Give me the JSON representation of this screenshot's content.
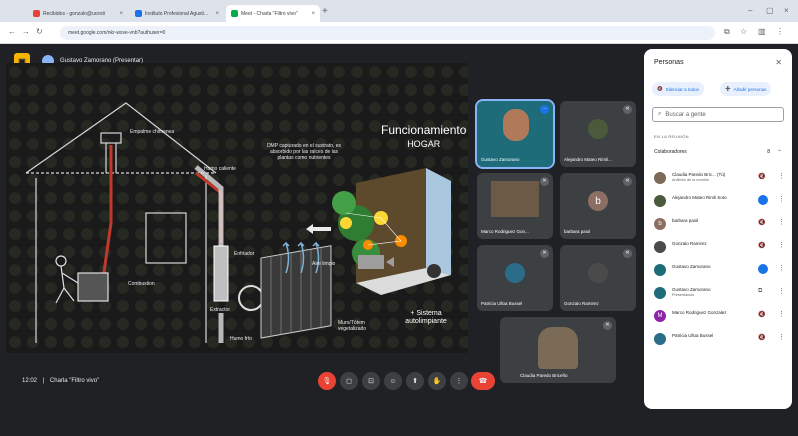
{
  "browser": {
    "tabs": [
      {
        "label": "Recibidos - gonzalo@ucesti",
        "fav": "#ea4335"
      },
      {
        "label": "Instituto Profesional Agusti...",
        "fav": "#1a73e8"
      },
      {
        "label": "Meet - Charla \"Filtro vivo\"",
        "fav": "#00ac47"
      }
    ],
    "url": "meet.google.com/nkr-wsve-vnb?authuser=0"
  },
  "presenter": {
    "name": "Gustavo Zamorano (Presentar)"
  },
  "slide": {
    "title": "Funcionamiento",
    "subtitle": "HOGAR",
    "labels": {
      "chimney": "Empalme chimenea",
      "hot_smoke": "Humo caliente",
      "cooler": "Enfriador",
      "clean_air": "Aire limpio",
      "combustion": "Combustion",
      "extractor": "Extractor",
      "cold_smoke": "Humo frío",
      "green_wall": "Muro/Tótem vegetalizado"
    },
    "note": "DMP capturado en el sustrato, es absorbido por las raíces de las plantas como nutrientes",
    "system": "+ Sistema autolimpiante"
  },
  "tiles": [
    {
      "name": "Gustavo Zamorano",
      "color": "#1e6b7a"
    },
    {
      "name": "Alejandro Mateo Rimli...",
      "color": "#4a5a3a"
    },
    {
      "name": "Marco Rodriguez Gon...",
      "color": "#5a4a3a"
    },
    {
      "name": "barbara paiol",
      "initial": "b",
      "color": "#8d6e63"
    },
    {
      "name": "Patricia Ulloa Bussel",
      "color": "#2b6c8a"
    },
    {
      "name": "Gonzalo Ramirez",
      "color": "#4a4a4a"
    },
    {
      "name": "Claudia Paredo Briceño",
      "color": "#7b6a55"
    }
  ],
  "controls": {
    "time": "12:02",
    "separator": "|",
    "meeting": "Charla \"Filtro vivo\""
  },
  "people": {
    "title": "Personas",
    "mute_all": "Silenciar a todos",
    "add_people": "Añadir personas",
    "search_placeholder": "Buscar a gente",
    "section": "EN LA REUNIÓN",
    "group": "Colaboradores",
    "group_count": "8",
    "list": [
      {
        "name": "Claudia Paredo Bric... (Tú)",
        "role": "Anfitrión de la reunión",
        "color": "#7b6a55",
        "icon": "mic-off"
      },
      {
        "name": "Alejandro Mateo Rimli Soto",
        "role": "",
        "color": "#4a5a3a",
        "icon": "speaking"
      },
      {
        "name": "barbara paiol",
        "role": "",
        "initial": "b",
        "color": "#8d6e63",
        "icon": "mic-off"
      },
      {
        "name": "Gonzalo Ramirez",
        "role": "",
        "color": "#4a4a4a",
        "icon": "mic-off"
      },
      {
        "name": "Gustavo Zamorano",
        "role": "",
        "color": "#1e6b7a",
        "icon": "speaking"
      },
      {
        "name": "Gustavo Zamorano",
        "role": "Presentación",
        "color": "#1e6b7a",
        "icon": "present"
      },
      {
        "name": "Marco Rodriguez Gonzalez",
        "role": "",
        "initial": "M",
        "color": "#8e24aa",
        "icon": "mic-off"
      },
      {
        "name": "Patricia Ulloa Bussel",
        "role": "",
        "color": "#2b6c8a",
        "icon": "mic-off"
      }
    ]
  }
}
